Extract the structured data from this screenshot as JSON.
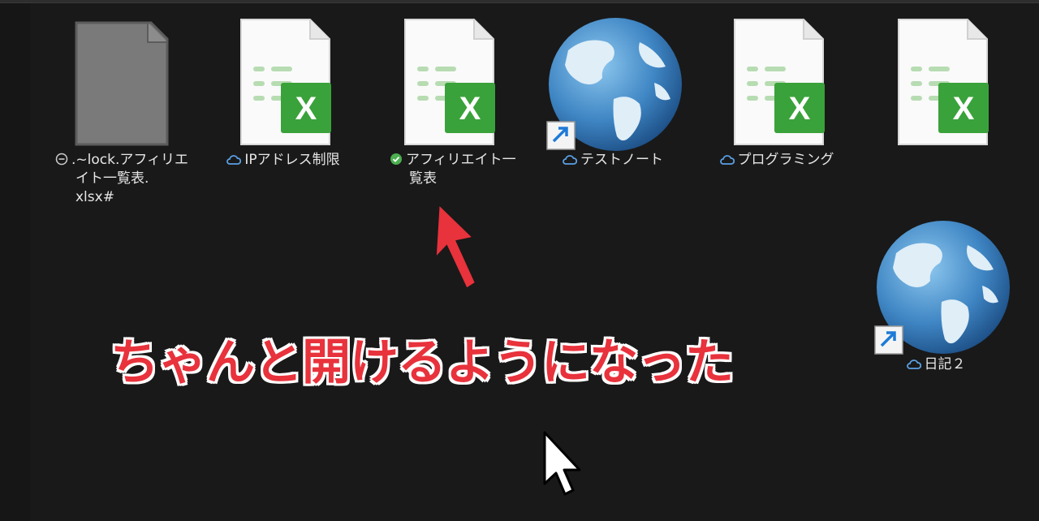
{
  "files": [
    {
      "id": "lock",
      "name_lines": [
        ".~lock.アフィリエ",
        "イト一覧表.",
        "xlsx#"
      ],
      "status_icon": "minus-circle-icon",
      "file_icon": "generic-file-icon"
    },
    {
      "id": "ip",
      "name": "IPアドレス制限",
      "status_icon": "cloud-icon",
      "file_icon": "excel-file-icon"
    },
    {
      "id": "affiliate",
      "name_lines": [
        "アフィリエイト一",
        "覧表"
      ],
      "status_icon": "check-circle-icon",
      "file_icon": "excel-file-icon"
    },
    {
      "id": "testnote",
      "name": "テストノート",
      "status_icon": "cloud-icon",
      "file_icon": "globe-shortcut-icon"
    },
    {
      "id": "programming",
      "name": "プログラミング",
      "status_icon": "cloud-icon",
      "file_icon": "excel-file-icon"
    },
    {
      "id": "unnamed-excel",
      "name": "",
      "file_icon": "excel-file-icon"
    },
    {
      "id": "diary",
      "name": "日記２",
      "status_icon": "cloud-icon",
      "file_icon": "globe-shortcut-icon"
    }
  ],
  "annotation": {
    "text": "ちゃんと開けるようになった",
    "color": "#e8323c"
  },
  "colors": {
    "background": "#191919",
    "excel_green": "#3aa23a",
    "cloud_blue": "#5aa0e6",
    "check_green": "#4caf50"
  }
}
